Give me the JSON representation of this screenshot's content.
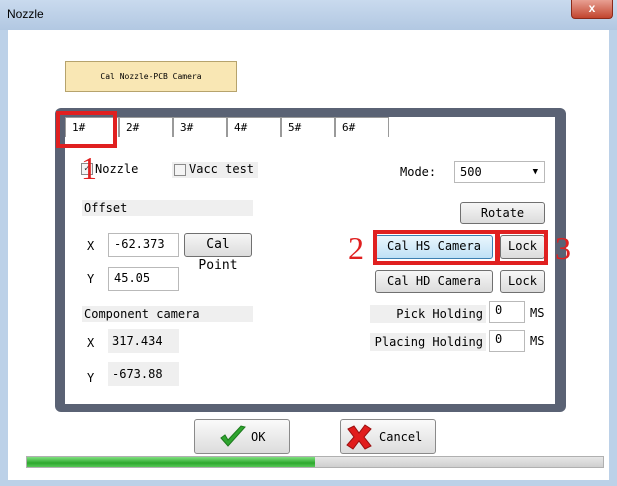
{
  "window": {
    "title": "Nozzle",
    "close": "x"
  },
  "cal_nozzle_button": "Cal Nozzle-PCB Camera",
  "tabs": [
    {
      "label": "1#",
      "active": true
    },
    {
      "label": "2#",
      "active": false
    },
    {
      "label": "3#",
      "active": false
    },
    {
      "label": "4#",
      "active": false
    },
    {
      "label": "5#",
      "active": false
    },
    {
      "label": "6#",
      "active": false
    }
  ],
  "checkboxes": {
    "nozzle": {
      "label": "Nozzle",
      "checked": true
    },
    "vacc": {
      "label": "Vacc test",
      "checked": false
    }
  },
  "mode": {
    "label": "Mode:",
    "value": "500"
  },
  "offset": {
    "header": "Offset",
    "x_label": "X",
    "x_value": "-62.373",
    "y_label": "Y",
    "y_value": "45.05",
    "cal_point": "Cal Point"
  },
  "component_camera": {
    "header": "Component camera",
    "x_label": "X",
    "x_value": "317.434",
    "y_label": "Y",
    "y_value": "-673.88"
  },
  "buttons": {
    "rotate": "Rotate",
    "cal_hs": "Cal HS Camera",
    "cal_hd": "Cal HD Camera",
    "lock": "Lock"
  },
  "pick_holding": {
    "label": "Pick Holding",
    "value": "0",
    "unit": "MS"
  },
  "placing_holding": {
    "label": "Placing Holding",
    "value": "0",
    "unit": "MS"
  },
  "annotations": [
    "1",
    "2",
    "3"
  ],
  "dialog_buttons": {
    "ok": "OK",
    "cancel": "Cancel"
  },
  "progress": {
    "fraction": 0.5
  },
  "colors": {
    "annotation": "#e02020",
    "progress": "#2ea82e",
    "panel": "#5a6274"
  }
}
